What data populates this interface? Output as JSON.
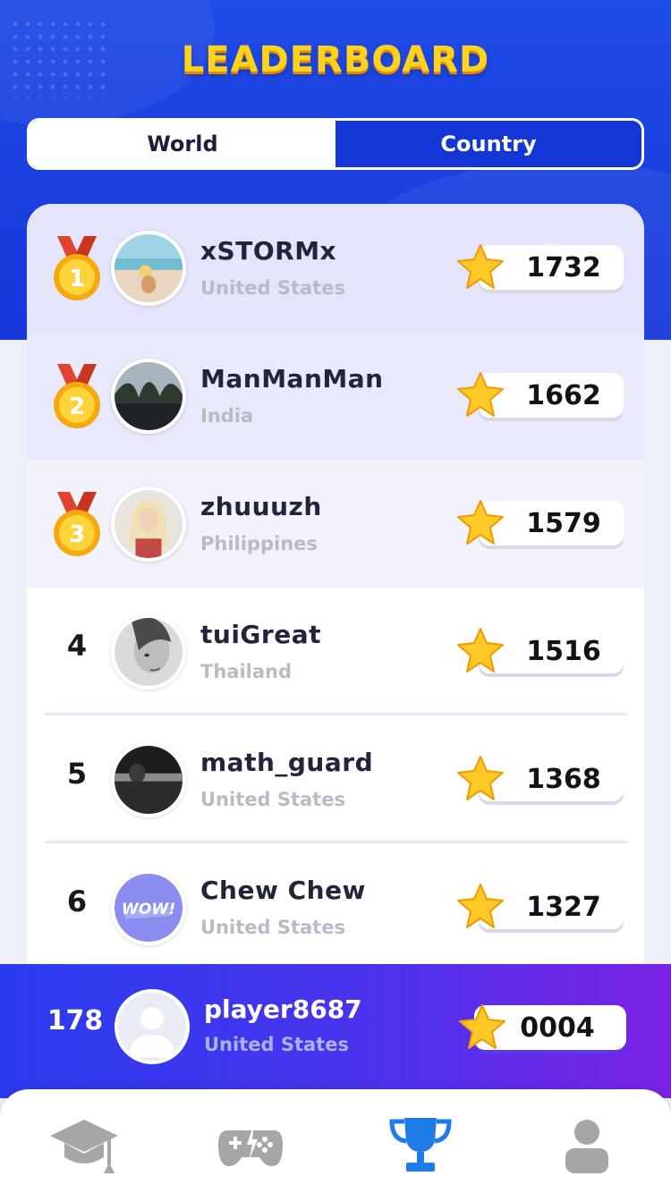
{
  "header": {
    "title": "LEADERBOARD"
  },
  "tabs": [
    {
      "label": "World",
      "active": false
    },
    {
      "label": "Country",
      "active": true
    }
  ],
  "leaderboard": [
    {
      "rank": "1",
      "name": "xSTORMx",
      "country": "United States",
      "score": "1732",
      "medal": "gold-medal-1"
    },
    {
      "rank": "2",
      "name": "ManManMan",
      "country": "India",
      "score": "1662",
      "medal": "gold-medal-2"
    },
    {
      "rank": "3",
      "name": "zhuuuzh",
      "country": "Philippines",
      "score": "1579",
      "medal": "gold-medal-3"
    },
    {
      "rank": "4",
      "name": "tuiGreat",
      "country": "Thailand",
      "score": "1516"
    },
    {
      "rank": "5",
      "name": "math_guard",
      "country": "United States",
      "score": "1368"
    },
    {
      "rank": "6",
      "name": "Chew Chew",
      "country": "United States",
      "score": "1327"
    }
  ],
  "current_user": {
    "rank": "178",
    "name": "player8687",
    "country": "United States",
    "score": "0004"
  },
  "avatar_badge_text": "WOW!",
  "nav": [
    {
      "icon": "graduation-cap-icon",
      "active": false
    },
    {
      "icon": "gamepad-icon",
      "active": false
    },
    {
      "icon": "trophy-icon",
      "active": true
    },
    {
      "icon": "profile-icon",
      "active": false
    }
  ],
  "colors": {
    "primary_blue": "#1637d9",
    "title_yellow": "#ffd21f",
    "star_yellow": "#ffc928",
    "nav_active": "#1e7be8",
    "nav_inactive": "#a6a6a6"
  }
}
